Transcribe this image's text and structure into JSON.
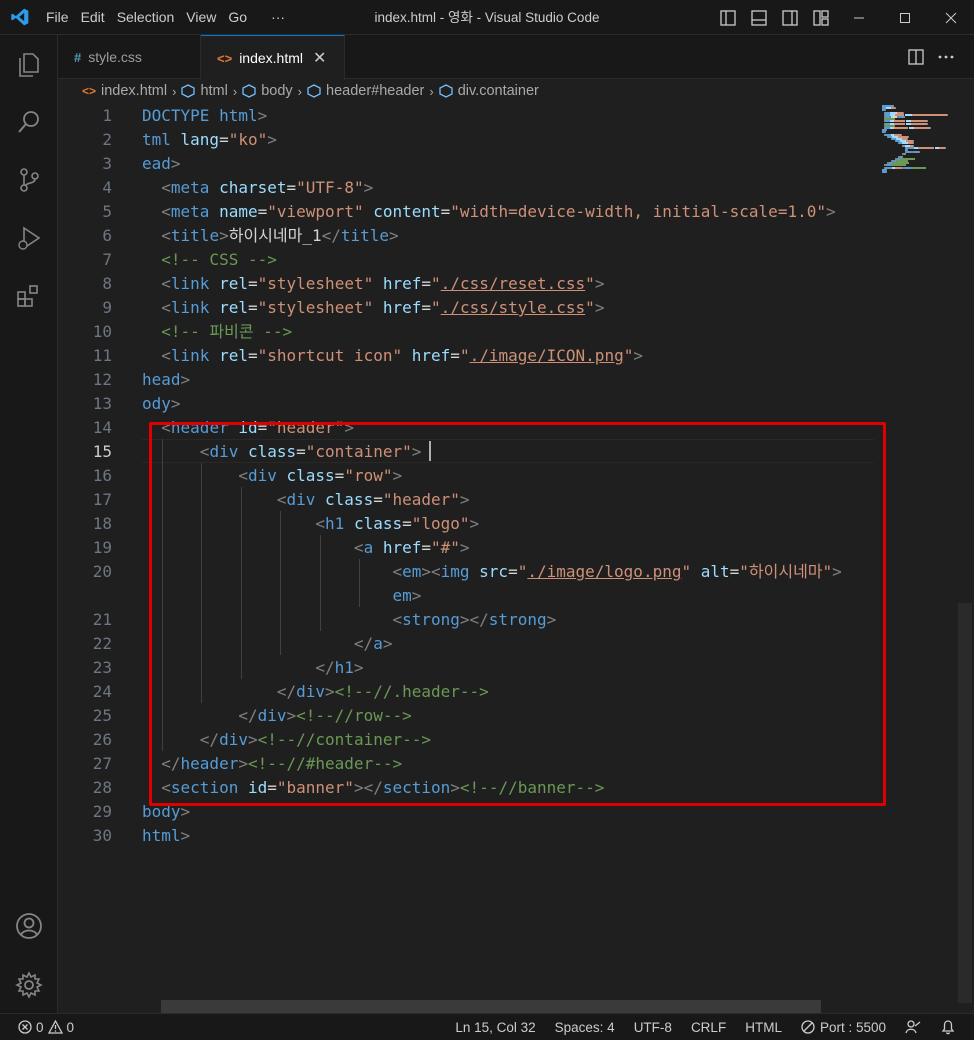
{
  "window": {
    "title": "index.html - 영화 - Visual Studio Code",
    "menu": [
      "File",
      "Edit",
      "Selection",
      "View",
      "Go",
      "···"
    ]
  },
  "tabs": [
    {
      "label": "style.css",
      "icon": "#",
      "active": false
    },
    {
      "label": "index.html",
      "icon": "<>",
      "active": true,
      "close": "✕"
    }
  ],
  "breadcrumb": {
    "file": "index.html",
    "items": [
      "html",
      "body",
      "header#header",
      "div.container"
    ]
  },
  "editor": {
    "cursor_line": 15,
    "lines": [
      {
        "n": "1",
        "parts": [
          [
            "tg",
            "DOCTYPE "
          ],
          [
            "tg",
            "html"
          ],
          [
            "t",
            ">"
          ]
        ]
      },
      {
        "n": "2",
        "parts": [
          [
            "tg",
            "tml "
          ],
          [
            "at",
            "lang"
          ],
          [
            "tx",
            "="
          ],
          [
            "st",
            "\"ko\""
          ],
          [
            "t",
            ">"
          ]
        ]
      },
      {
        "n": "3",
        "parts": [
          [
            "tg",
            "ead"
          ],
          [
            "t",
            ">"
          ]
        ]
      },
      {
        "n": "4",
        "parts": [
          [
            "tx",
            "  "
          ],
          [
            "t",
            "<"
          ],
          [
            "tg",
            "meta "
          ],
          [
            "at",
            "charset"
          ],
          [
            "tx",
            "="
          ],
          [
            "st",
            "\"UTF-8\""
          ],
          [
            "t",
            ">"
          ]
        ]
      },
      {
        "n": "5",
        "parts": [
          [
            "tx",
            "  "
          ],
          [
            "t",
            "<"
          ],
          [
            "tg",
            "meta "
          ],
          [
            "at",
            "name"
          ],
          [
            "tx",
            "="
          ],
          [
            "st",
            "\"viewport\""
          ],
          [
            "tx",
            " "
          ],
          [
            "at",
            "content"
          ],
          [
            "tx",
            "="
          ],
          [
            "st",
            "\"width=device-width, initial-scale=1.0\""
          ],
          [
            "t",
            ">"
          ]
        ]
      },
      {
        "n": "6",
        "parts": [
          [
            "tx",
            "  "
          ],
          [
            "t",
            "<"
          ],
          [
            "tg",
            "title"
          ],
          [
            "t",
            ">"
          ],
          [
            "tx",
            "하이시네마_1"
          ],
          [
            "t",
            "</"
          ],
          [
            "tg",
            "title"
          ],
          [
            "t",
            ">"
          ]
        ]
      },
      {
        "n": "7",
        "parts": [
          [
            "tx",
            "  "
          ],
          [
            "cm",
            "<!-- CSS -->"
          ]
        ]
      },
      {
        "n": "8",
        "parts": [
          [
            "tx",
            "  "
          ],
          [
            "t",
            "<"
          ],
          [
            "tg",
            "link "
          ],
          [
            "at",
            "rel"
          ],
          [
            "tx",
            "="
          ],
          [
            "st",
            "\"stylesheet\""
          ],
          [
            "tx",
            " "
          ],
          [
            "at",
            "href"
          ],
          [
            "tx",
            "="
          ],
          [
            "st",
            "\""
          ],
          [
            "stu",
            "./css/reset.css"
          ],
          [
            "st",
            "\""
          ],
          [
            "t",
            ">"
          ]
        ]
      },
      {
        "n": "9",
        "parts": [
          [
            "tx",
            "  "
          ],
          [
            "t",
            "<"
          ],
          [
            "tg",
            "link "
          ],
          [
            "at",
            "rel"
          ],
          [
            "tx",
            "="
          ],
          [
            "st",
            "\"stylesheet\""
          ],
          [
            "tx",
            " "
          ],
          [
            "at",
            "href"
          ],
          [
            "tx",
            "="
          ],
          [
            "st",
            "\""
          ],
          [
            "stu",
            "./css/style.css"
          ],
          [
            "st",
            "\""
          ],
          [
            "t",
            ">"
          ]
        ]
      },
      {
        "n": "10",
        "parts": [
          [
            "tx",
            "  "
          ],
          [
            "cm",
            "<!-- 파비콘 -->"
          ]
        ]
      },
      {
        "n": "11",
        "parts": [
          [
            "tx",
            "  "
          ],
          [
            "t",
            "<"
          ],
          [
            "tg",
            "link "
          ],
          [
            "at",
            "rel"
          ],
          [
            "tx",
            "="
          ],
          [
            "st",
            "\"shortcut icon\""
          ],
          [
            "tx",
            " "
          ],
          [
            "at",
            "href"
          ],
          [
            "tx",
            "="
          ],
          [
            "st",
            "\""
          ],
          [
            "stu",
            "./image/ICON.png"
          ],
          [
            "st",
            "\""
          ],
          [
            "t",
            ">"
          ]
        ]
      },
      {
        "n": "12",
        "parts": [
          [
            "tg",
            "head"
          ],
          [
            "t",
            ">"
          ]
        ]
      },
      {
        "n": "13",
        "parts": [
          [
            "tg",
            "ody"
          ],
          [
            "t",
            ">"
          ]
        ]
      },
      {
        "n": "14",
        "parts": [
          [
            "tx",
            "  "
          ],
          [
            "t",
            "<"
          ],
          [
            "tg",
            "header "
          ],
          [
            "at",
            "id"
          ],
          [
            "tx",
            "="
          ],
          [
            "st",
            "\"header\""
          ],
          [
            "t",
            ">"
          ]
        ]
      },
      {
        "n": "15",
        "parts": [
          [
            "tx",
            "      "
          ],
          [
            "t",
            "<"
          ],
          [
            "tg",
            "div "
          ],
          [
            "at",
            "class"
          ],
          [
            "tx",
            "="
          ],
          [
            "st",
            "\"container\""
          ],
          [
            "t",
            ">"
          ]
        ]
      },
      {
        "n": "16",
        "parts": [
          [
            "tx",
            "          "
          ],
          [
            "t",
            "<"
          ],
          [
            "tg",
            "div "
          ],
          [
            "at",
            "class"
          ],
          [
            "tx",
            "="
          ],
          [
            "st",
            "\"row\""
          ],
          [
            "t",
            ">"
          ]
        ]
      },
      {
        "n": "17",
        "parts": [
          [
            "tx",
            "              "
          ],
          [
            "t",
            "<"
          ],
          [
            "tg",
            "div "
          ],
          [
            "at",
            "class"
          ],
          [
            "tx",
            "="
          ],
          [
            "st",
            "\"header\""
          ],
          [
            "t",
            ">"
          ]
        ]
      },
      {
        "n": "18",
        "parts": [
          [
            "tx",
            "                  "
          ],
          [
            "t",
            "<"
          ],
          [
            "tg",
            "h1 "
          ],
          [
            "at",
            "class"
          ],
          [
            "tx",
            "="
          ],
          [
            "st",
            "\"logo\""
          ],
          [
            "t",
            ">"
          ]
        ]
      },
      {
        "n": "19",
        "parts": [
          [
            "tx",
            "                      "
          ],
          [
            "t",
            "<"
          ],
          [
            "tg",
            "a "
          ],
          [
            "at",
            "href"
          ],
          [
            "tx",
            "="
          ],
          [
            "st",
            "\"#\""
          ],
          [
            "t",
            ">"
          ]
        ]
      },
      {
        "n": "20",
        "parts": [
          [
            "tx",
            "                          "
          ],
          [
            "t",
            "<"
          ],
          [
            "tg",
            "em"
          ],
          [
            "t",
            "><"
          ],
          [
            "tg",
            "img "
          ],
          [
            "at",
            "src"
          ],
          [
            "tx",
            "="
          ],
          [
            "st",
            "\""
          ],
          [
            "stu",
            "./image/logo.png"
          ],
          [
            "st",
            "\""
          ],
          [
            "tx",
            " "
          ],
          [
            "at",
            "alt"
          ],
          [
            "tx",
            "="
          ],
          [
            "st",
            "\"하이시네마\""
          ],
          [
            "t",
            ">"
          ]
        ]
      },
      {
        "n": "",
        "parts": [
          [
            "tx",
            "                          "
          ],
          [
            "tg",
            "em"
          ],
          [
            "t",
            ">"
          ]
        ]
      },
      {
        "n": "21",
        "parts": [
          [
            "tx",
            "                          "
          ],
          [
            "t",
            "<"
          ],
          [
            "tg",
            "strong"
          ],
          [
            "t",
            "></"
          ],
          [
            "tg",
            "strong"
          ],
          [
            "t",
            ">"
          ]
        ]
      },
      {
        "n": "22",
        "parts": [
          [
            "tx",
            "                      "
          ],
          [
            "t",
            "</"
          ],
          [
            "tg",
            "a"
          ],
          [
            "t",
            ">"
          ]
        ]
      },
      {
        "n": "23",
        "parts": [
          [
            "tx",
            "                  "
          ],
          [
            "t",
            "</"
          ],
          [
            "tg",
            "h1"
          ],
          [
            "t",
            ">"
          ]
        ]
      },
      {
        "n": "24",
        "parts": [
          [
            "tx",
            "              "
          ],
          [
            "t",
            "</"
          ],
          [
            "tg",
            "div"
          ],
          [
            "t",
            ">"
          ],
          [
            "cm",
            "<!--//.header-->"
          ]
        ]
      },
      {
        "n": "25",
        "parts": [
          [
            "tx",
            "          "
          ],
          [
            "t",
            "</"
          ],
          [
            "tg",
            "div"
          ],
          [
            "t",
            ">"
          ],
          [
            "cm",
            "<!--//row-->"
          ]
        ]
      },
      {
        "n": "26",
        "parts": [
          [
            "tx",
            "      "
          ],
          [
            "t",
            "</"
          ],
          [
            "tg",
            "div"
          ],
          [
            "t",
            ">"
          ],
          [
            "cm",
            "<!--//container-->"
          ]
        ]
      },
      {
        "n": "27",
        "parts": [
          [
            "tx",
            "  "
          ],
          [
            "t",
            "</"
          ],
          [
            "tg",
            "header"
          ],
          [
            "t",
            ">"
          ],
          [
            "cm",
            "<!--//#header-->"
          ]
        ]
      },
      {
        "n": "28",
        "parts": [
          [
            "tx",
            "  "
          ],
          [
            "t",
            "<"
          ],
          [
            "tg",
            "section "
          ],
          [
            "at",
            "id"
          ],
          [
            "tx",
            "="
          ],
          [
            "st",
            "\"banner\""
          ],
          [
            "t",
            "></"
          ],
          [
            "tg",
            "section"
          ],
          [
            "t",
            ">"
          ],
          [
            "cm",
            "<!--//banner-->"
          ]
        ]
      },
      {
        "n": "29",
        "parts": [
          [
            "tg",
            "body"
          ],
          [
            "t",
            ">"
          ]
        ]
      },
      {
        "n": "30",
        "parts": [
          [
            "tg",
            "html"
          ],
          [
            "t",
            ">"
          ]
        ]
      }
    ]
  },
  "status": {
    "errors": "0",
    "warnings": "0",
    "position": "Ln 15, Col 32",
    "spaces": "Spaces: 4",
    "encoding": "UTF-8",
    "eol": "CRLF",
    "language": "HTML",
    "port": "Port : 5500"
  },
  "colors": {
    "highlight_box": "#e00000",
    "accent": "#0078d4"
  }
}
